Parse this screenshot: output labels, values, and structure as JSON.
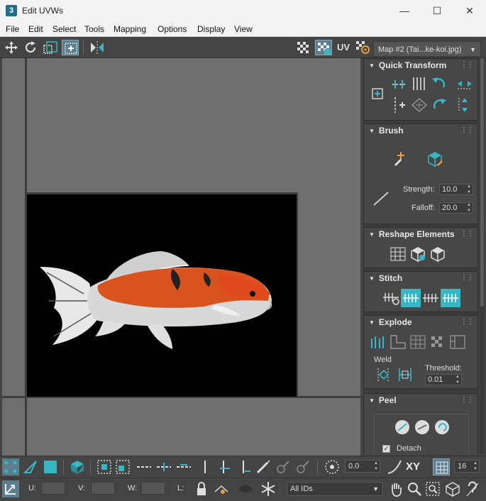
{
  "window": {
    "app_icon_text": "3",
    "title": "Edit UVWs",
    "minimize": "—",
    "maximize": "☐",
    "close": "✕"
  },
  "menu": [
    "File",
    "Edit",
    "Select",
    "Tools",
    "Mapping",
    "Options",
    "Display",
    "View"
  ],
  "toolbar": {
    "uv_label": "UV",
    "map_select": "Map #2 (Tai...ke-koi.jpg)"
  },
  "panel": {
    "quick_transform": {
      "title": "Quick Transform"
    },
    "brush": {
      "title": "Brush",
      "strength_label": "Strength:",
      "strength_value": "10.0",
      "falloff_label": "Falloff:",
      "falloff_value": "20.0"
    },
    "reshape": {
      "title": "Reshape Elements"
    },
    "stitch": {
      "title": "Stitch"
    },
    "explode": {
      "title": "Explode",
      "weld_label": "Weld",
      "threshold_label": "Threshold:",
      "threshold_value": "0.01"
    },
    "peel": {
      "title": "Peel",
      "detach_label": "Detach",
      "detach_checked": true
    }
  },
  "bottom": {
    "rotation_value": "0.0",
    "xy_label": "XY",
    "grid_value": "16",
    "u_label": "U:",
    "v_label": "V:",
    "w_label": "W:",
    "l_label": "L:",
    "ids_select": "All IDs"
  },
  "colors": {
    "accent": "#37b6c3",
    "viewport": "#6e6e6e",
    "panel": "#474747",
    "titlebar": "#f3f3f3"
  }
}
